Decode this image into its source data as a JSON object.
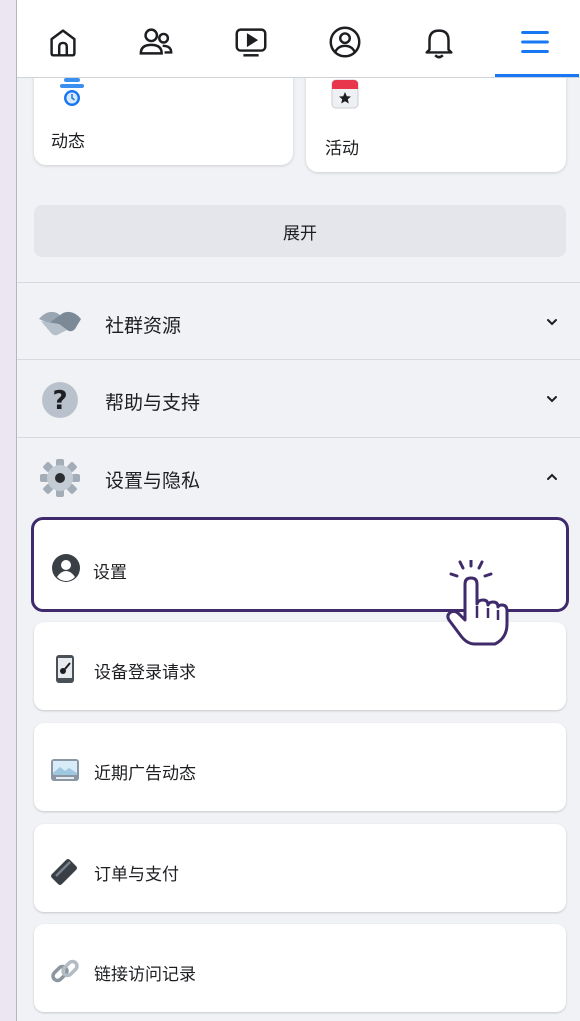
{
  "topnav": {
    "items": [
      {
        "name": "home-icon",
        "active": false
      },
      {
        "name": "friends-icon",
        "active": false
      },
      {
        "name": "video-icon",
        "active": false
      },
      {
        "name": "profile-icon",
        "active": false
      },
      {
        "name": "notifications-icon",
        "active": false
      },
      {
        "name": "menu-icon",
        "active": true
      }
    ],
    "accent_color": "#1877f2"
  },
  "shortcuts": [
    {
      "label": "动态",
      "icon": "feeds-icon"
    },
    {
      "label": "活动",
      "icon": "events-icon"
    }
  ],
  "expand_label": "展开",
  "sections": [
    {
      "label": "社群资源",
      "icon": "handshake-icon",
      "expanded": false
    },
    {
      "label": "帮助与支持",
      "icon": "help-icon",
      "expanded": false
    },
    {
      "label": "设置与隐私",
      "icon": "gear-icon",
      "expanded": true
    }
  ],
  "settings_items": [
    {
      "label": "设置",
      "icon": "user-circle-icon",
      "highlighted": true
    },
    {
      "label": "设备登录请求",
      "icon": "device-icon"
    },
    {
      "label": "近期广告动态",
      "icon": "ad-activity-icon"
    },
    {
      "label": "订单与支付",
      "icon": "payment-icon"
    },
    {
      "label": "链接访问记录",
      "icon": "link-icon"
    }
  ]
}
